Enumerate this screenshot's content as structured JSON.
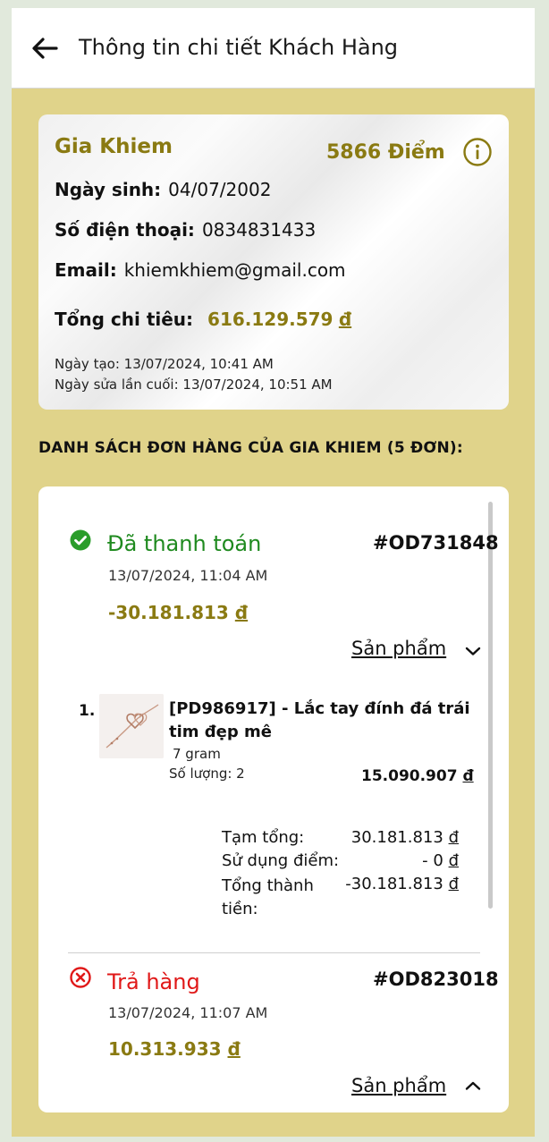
{
  "header": {
    "title": "Thông tin chi tiết Khách Hàng"
  },
  "customer": {
    "name": "Gia Khiem",
    "points": "5866 Điểm",
    "birthday_label": "Ngày sinh:",
    "birthday": "04/07/2002",
    "phone_label": "Số điện thoại:",
    "phone": "0834831433",
    "email_label": "Email:",
    "email": "khiemkhiem@gmail.com",
    "spending_label": "Tổng chi tiêu:",
    "spending": "616.129.579",
    "currency": "đ",
    "created": "Ngày tạo: 13/07/2024, 10:41 AM",
    "modified": "Ngày sửa lần cuối: 13/07/2024, 10:51 AM"
  },
  "orders_title": "DANH SÁCH ĐƠN HÀNG CỦA GIA KHIEM (5 ĐƠN):",
  "orders": [
    {
      "status": "Đã thanh toán",
      "status_color": "#1f8a1f",
      "code": "#OD731848",
      "date": "13/07/2024, 11:04 AM",
      "amount": "-30.181.813",
      "currency": "đ",
      "toggle": "Sản phẩm",
      "toggle_icon": "chevron-down-icon",
      "items": [
        {
          "num": "1.",
          "name": "[PD986917] - Lắc tay đính đá trái tim đẹp mê",
          "weight": "7 gram",
          "qty": "Số lượng: 2",
          "price": "15.090.907",
          "currency": "đ"
        }
      ],
      "summary": {
        "subtotal_label": "Tạm tổng:",
        "subtotal": "30.181.813",
        "points_label": "Sử dụng điểm:",
        "points": "- 0",
        "total_label": "Tổng thành tiền:",
        "total": "-30.181.813",
        "currency": "đ"
      }
    },
    {
      "status": "Trả hàng",
      "status_color": "#e01818",
      "code": "#OD823018",
      "date": "13/07/2024, 11:07 AM",
      "amount": "10.313.933",
      "currency": "đ",
      "toggle": "Sản phẩm",
      "toggle_icon": "chevron-up-icon"
    }
  ],
  "colors": {
    "background": "#e0d38a",
    "gold": "#8a7a12",
    "success": "#1f8a1f",
    "danger": "#e01818"
  }
}
